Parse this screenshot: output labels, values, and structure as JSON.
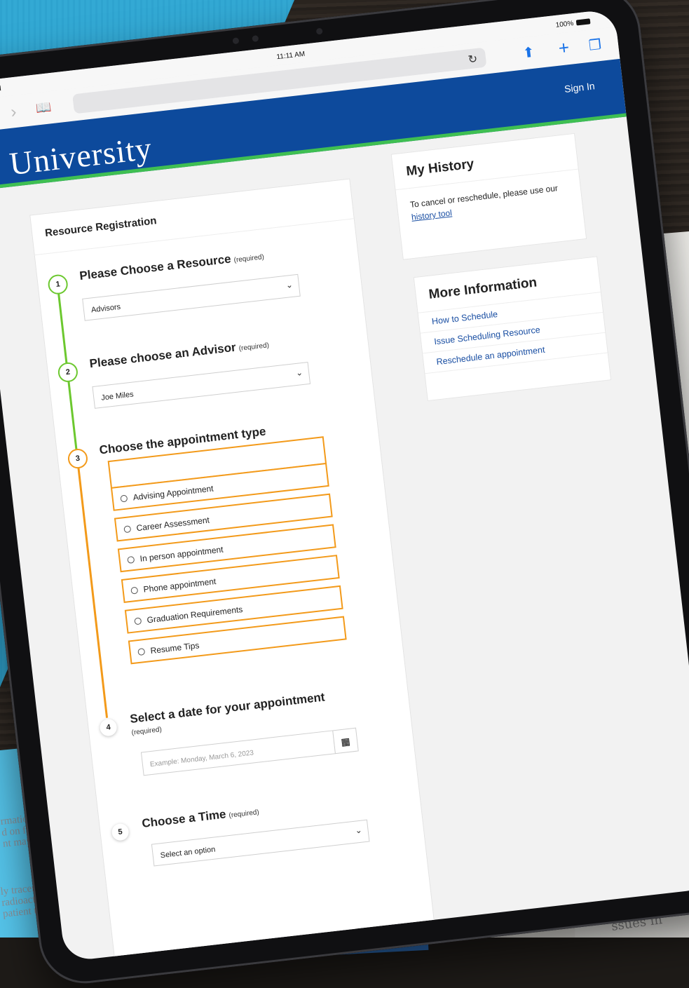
{
  "status_bar": {
    "device": "iPad",
    "time": "11:11 AM",
    "battery": "100%"
  },
  "header": {
    "logo": "University",
    "sign_in": "Sign In"
  },
  "registration": {
    "title": "Resource Registration",
    "steps": [
      {
        "number": "1",
        "heading": "Please Choose a Resource",
        "required": "(required)",
        "value": "Advisors"
      },
      {
        "number": "2",
        "heading": "Please choose an Advisor",
        "required": "(required)",
        "value": "Joe Miles"
      },
      {
        "number": "3",
        "heading": "Choose the appointment type",
        "options": [
          "Advising Appointment",
          "Career Assessment",
          "In person appointment",
          "Phone appointment",
          "Graduation Requirements",
          "Resume Tips"
        ]
      },
      {
        "number": "4",
        "heading": "Select a date for your appointment",
        "required": "(required)",
        "placeholder": "Example: Monday, March 6, 2023"
      },
      {
        "number": "5",
        "heading": "Choose a Time",
        "required": "(required)",
        "value": "Select an option"
      }
    ]
  },
  "history": {
    "title": "My History",
    "text": "To cancel or reschedule, please use our",
    "link": "history tool"
  },
  "more_info": {
    "title": "More Information",
    "links": [
      "How to Schedule",
      "Issue Scheduling Resource",
      "Reschedule an appointment"
    ]
  },
  "background_text": {
    "paper_lines_1": [
      "rmation is translated into a tw",
      "d on film.",
      "nt may be repositioned in the"
    ],
    "paper_lines_2": [
      "ly tracer doses of radioisotope",
      "radioactive exposure to other p",
      "patient that the radioactive sub"
    ],
    "notepad": "ssues in"
  },
  "colors": {
    "brand_blue": "#0d4a9c",
    "accent_green": "#3fbf52",
    "step_green": "#6cc82f",
    "step_orange": "#f39a1a",
    "link_blue": "#1a4fa3"
  }
}
